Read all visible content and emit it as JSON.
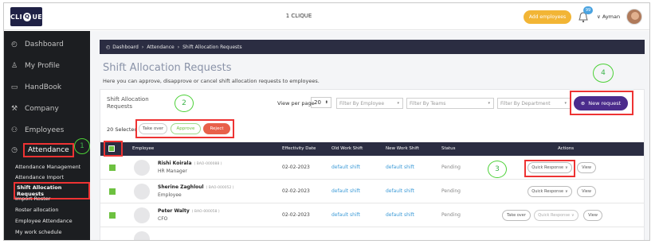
{
  "topbar": {
    "logo": "CLIQUE",
    "title": "1 CLIQUE",
    "add_employees": "Add employees",
    "notification_count": "99",
    "user_name": "Ayman"
  },
  "sidebar": {
    "items": [
      {
        "label": "Dashboard",
        "icon": "dashboard-icon"
      },
      {
        "label": "My Profile",
        "icon": "user-icon"
      },
      {
        "label": "HandBook",
        "icon": "book-icon"
      },
      {
        "label": "Company",
        "icon": "wrench-icon"
      },
      {
        "label": "Employees",
        "icon": "group-icon"
      },
      {
        "label": "Attendance",
        "icon": "clock-icon"
      }
    ],
    "subitems": [
      "Attendance Management",
      "Attendance Import",
      "Shift Allocation Requests",
      "Import Roster",
      "Roster allocation",
      "Employee Attendance",
      "My work schedule"
    ]
  },
  "annotations": [
    "1",
    "2",
    "3",
    "4"
  ],
  "breadcrumb": [
    "Dashboard",
    "Attendance",
    "Shift Allocation Requests"
  ],
  "page": {
    "title": "Shift Allocation Requests",
    "subtitle": "Here you can approve, disapprove or cancel shift allocation requests to employees."
  },
  "card": {
    "title": "Shift Allocation Requests",
    "view_per_page_label": "View per page",
    "view_per_page_value": "20",
    "filters": [
      "Filter By Employee",
      "Filter By Teams",
      "Filter By Department"
    ],
    "new_request": "New request",
    "selected": "20 Selected",
    "bulk": {
      "take_over": "Take over",
      "approve": "Approve",
      "reject": "Reject"
    }
  },
  "table": {
    "headers": [
      "Employee",
      "Effectivity Date",
      "Old Work Shift",
      "New Work Shift",
      "Status",
      "Actions"
    ],
    "rows": [
      {
        "name": "Rishi Koirala",
        "code": "( BAO-000088 )",
        "role": "HR Manager",
        "date": "02-02-2023",
        "old": "default shift",
        "new": "default shift",
        "status": "Pending"
      },
      {
        "name": "Sherine Zaghloul",
        "code": "( BAO-000052 )",
        "role": "Employee",
        "date": "02-02-2023",
        "old": "default shift",
        "new": "default shift",
        "status": "Pending"
      },
      {
        "name": "Peter Walty",
        "code": "( BAO-000058 )",
        "role": "CFO",
        "date": "02-02-2023",
        "old": "default shift",
        "new": "default shift",
        "status": "Pending"
      }
    ],
    "actions": {
      "quick_response": "Quick Response",
      "view": "View",
      "take_over": "Take over"
    }
  },
  "colors": {
    "sidebar": "#1c1e21",
    "header": "#2b2d42",
    "accent": "#4b2c8c",
    "highlight": "#e33333",
    "annotation": "#4cd137",
    "checkbox": "#6dc140",
    "link": "#3d9bd7",
    "add_button": "#f2b535"
  }
}
